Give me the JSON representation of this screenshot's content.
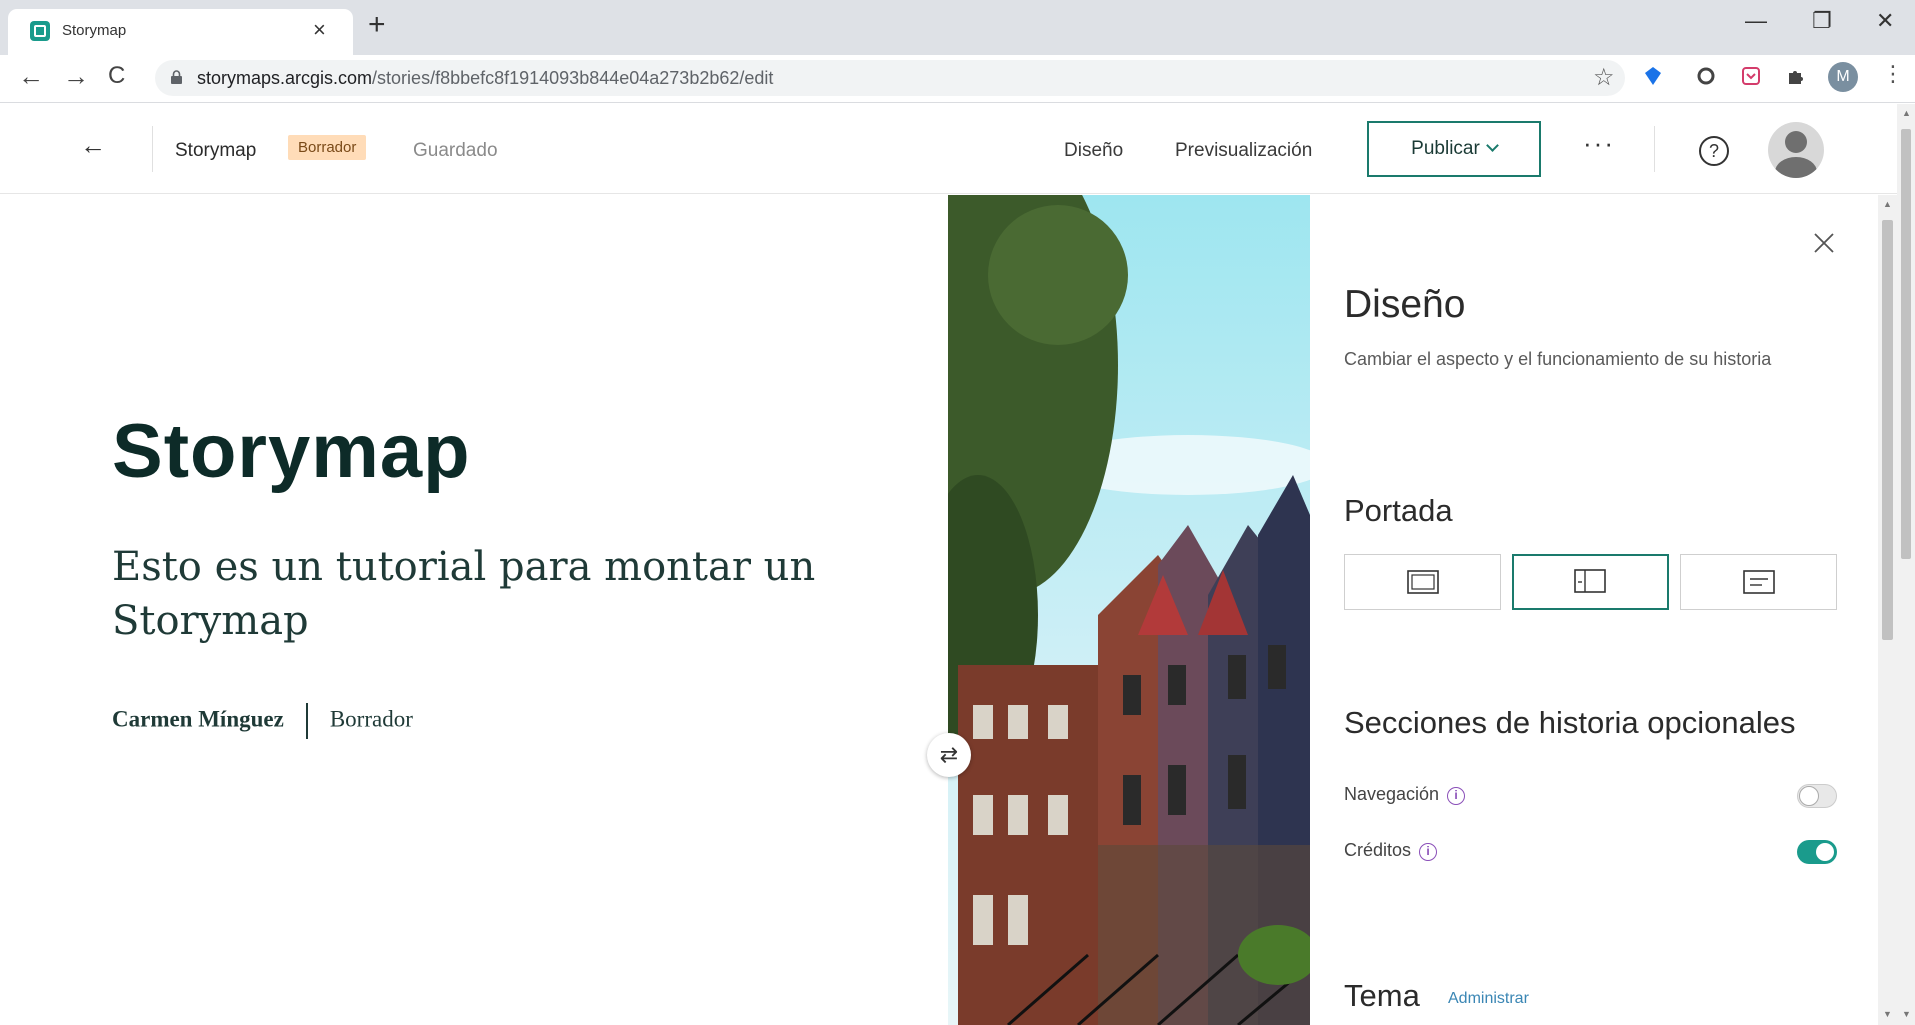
{
  "browser": {
    "tab_title": "Storymap",
    "tab_close": "×",
    "new_tab": "+",
    "minimize": "—",
    "restore": "❐",
    "close": "✕",
    "url_host": "storymaps.arcgis.com",
    "url_path": "/stories/f8bbefc8f1914093b844e04a273b2b62/edit",
    "profile_letter": "M"
  },
  "header": {
    "back": "←",
    "title": "Storymap",
    "status_badge": "Borrador",
    "save_status": "Guardado",
    "design_link": "Diseño",
    "preview_link": "Previsualización",
    "publish_label": "Publicar",
    "more": "···",
    "help": "?"
  },
  "story": {
    "title": "Storymap",
    "subtitle": "Esto es un tutorial para montar un Storymap",
    "author": "Carmen Mínguez",
    "status": "Borrador",
    "swap": "⇄"
  },
  "design_panel": {
    "title": "Diseño",
    "description": "Cambiar el aspecto y el funcionamiento de su historia",
    "cover_section": "Portada",
    "optional_section": "Secciones de historia opcionales",
    "navigation_label": "Navegación",
    "navigation_enabled": false,
    "credits_label": "Créditos",
    "credits_enabled": true,
    "info_glyph": "i",
    "theme_section": "Tema",
    "theme_manage": "Administrar"
  },
  "colors": {
    "accent": "#1a9b8c",
    "badge_bg": "#ffdcb8",
    "title_text": "#0d2b28"
  }
}
